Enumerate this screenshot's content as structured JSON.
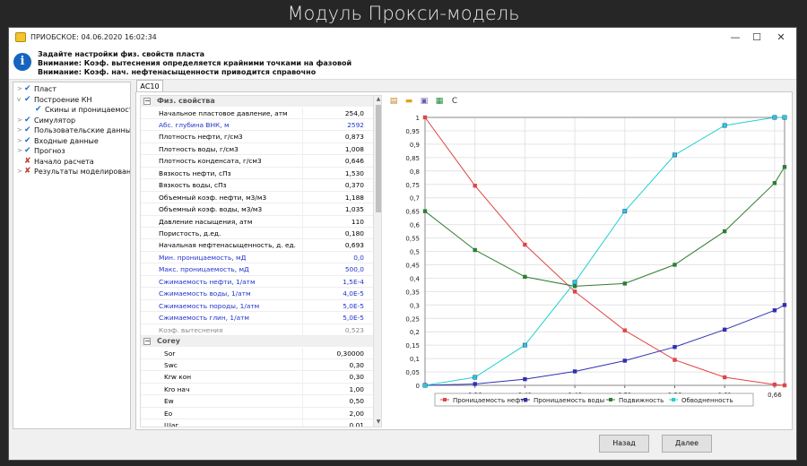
{
  "banner": "Модуль Прокси-модель",
  "window": {
    "title": "ПРИОБСКОЕ: 04.06.2020 16:02:34",
    "controls": [
      "—",
      "☐",
      "✕"
    ]
  },
  "info": {
    "lines": [
      "Задайте настройки физ. свойств пласта",
      "Внимание: Коэф. вытеснения определяется крайними точками на фазовой",
      "Внимание: Коэф. нач. нефтенасыщенности приводится справочно"
    ]
  },
  "tree": [
    {
      "label": "Пласт",
      "status": "ok",
      "level": 0,
      "expander": ">"
    },
    {
      "label": "Построение КН",
      "status": "ok",
      "level": 0,
      "expander": "v"
    },
    {
      "label": "Скины и проницаемость",
      "status": "ok",
      "level": 1,
      "expander": ""
    },
    {
      "label": "Симулятор",
      "status": "ok",
      "level": 0,
      "expander": ">"
    },
    {
      "label": "Пользовательские данные",
      "status": "ok",
      "level": 0,
      "expander": ">"
    },
    {
      "label": "Входные данные",
      "status": "ok",
      "level": 0,
      "expander": ">"
    },
    {
      "label": "Прогноз",
      "status": "ok",
      "level": 0,
      "expander": ">"
    },
    {
      "label": "Начало расчета",
      "status": "bad",
      "level": 0,
      "expander": ""
    },
    {
      "label": "Результаты моделирования",
      "status": "bad",
      "level": 0,
      "expander": ">"
    }
  ],
  "tab": "АС10",
  "properties": {
    "section1": "Физ. свойства",
    "rows1": [
      {
        "name": "Начальное пластовое давление, атм",
        "value": "254,0",
        "style": ""
      },
      {
        "name": "Абс. глубина ВНК, м",
        "value": "2592",
        "style": "blue"
      },
      {
        "name": "Плотность нефти, г/см3",
        "value": "0,873",
        "style": ""
      },
      {
        "name": "Плотность воды, г/см3",
        "value": "1,008",
        "style": ""
      },
      {
        "name": "Плотность конденсата, г/см3",
        "value": "0,646",
        "style": ""
      },
      {
        "name": "Вязкость нефти, сПз",
        "value": "1,530",
        "style": ""
      },
      {
        "name": "Вязкость воды, сПз",
        "value": "0,370",
        "style": ""
      },
      {
        "name": "Объемный коэф. нефти, м3/м3",
        "value": "1,188",
        "style": ""
      },
      {
        "name": "Объемный коэф. воды, м3/м3",
        "value": "1,035",
        "style": ""
      },
      {
        "name": "Давление насыщения, атм",
        "value": "110",
        "style": ""
      },
      {
        "name": "Пористость, д.ед.",
        "value": "0,180",
        "style": ""
      },
      {
        "name": "Начальная нефтенасыщенность, д. ед.",
        "value": "0,693",
        "style": ""
      },
      {
        "name": "Мин. проницаемость, мД",
        "value": "0,0",
        "style": "blue"
      },
      {
        "name": "Макс. проницаемость, мД",
        "value": "500,0",
        "style": "blue"
      },
      {
        "name": "Сжимаемость нефти, 1/атм",
        "value": "1,5E-4",
        "style": "blue"
      },
      {
        "name": "Сжимаемость воды, 1/атм",
        "value": "4,0E-5",
        "style": "blue"
      },
      {
        "name": "Сжимаемость породы, 1/атм",
        "value": "5,0E-5",
        "style": "blue"
      },
      {
        "name": "Сжимаемость глин, 1/атм",
        "value": "5,0E-5",
        "style": "blue"
      },
      {
        "name": "Коэф. вытеснения",
        "value": "0,523",
        "style": "gray"
      }
    ],
    "section2": "Corey",
    "rows2": [
      {
        "name": "Sor",
        "value": "0,30000",
        "style": "sub"
      },
      {
        "name": "Swc",
        "value": "0,30",
        "style": "sub"
      },
      {
        "name": "Krw кон",
        "value": "0,30",
        "style": "sub"
      },
      {
        "name": "Kro нач",
        "value": "1,00",
        "style": "sub"
      },
      {
        "name": "Ew",
        "value": "0,50",
        "style": "sub"
      },
      {
        "name": "Eo",
        "value": "2,00",
        "style": "sub"
      },
      {
        "name": "Шаг",
        "value": "0,01",
        "style": "sub"
      }
    ]
  },
  "chart_toolbar": {
    "icons": [
      "export-icon",
      "open-folder-icon",
      "save-icon",
      "excel-icon",
      "refresh-icon"
    ],
    "refresh_label": "C"
  },
  "chart_data": {
    "type": "line",
    "x": [
      0.31,
      0.36,
      0.41,
      0.46,
      0.51,
      0.56,
      0.61,
      0.66,
      0.67
    ],
    "series": [
      {
        "name": "Проницаемость нефти",
        "color": "#e04545",
        "values": [
          1.0,
          0.745,
          0.525,
          0.35,
          0.205,
          0.095,
          0.03,
          0.003,
          0.0
        ]
      },
      {
        "name": "Проницаемость воды",
        "color": "#3030b0",
        "values": [
          0.0,
          0.005,
          0.023,
          0.052,
          0.092,
          0.143,
          0.208,
          0.28,
          0.3
        ]
      },
      {
        "name": "Подвижность",
        "color": "#2e7d32",
        "values": [
          0.65,
          0.505,
          0.405,
          0.37,
          0.38,
          0.45,
          0.575,
          0.755,
          0.815
        ]
      },
      {
        "name": "Обводненность",
        "color": "#20d0d0",
        "values": [
          0.0,
          0.03,
          0.15,
          0.385,
          0.65,
          0.86,
          0.97,
          1.0,
          1.0
        ]
      }
    ],
    "xticks": [
      "0,36",
      "0,41",
      "0,46",
      "0,51",
      "0,56",
      "0,61",
      "0,66"
    ],
    "xtick_values": [
      0.36,
      0.41,
      0.46,
      0.51,
      0.56,
      0.61,
      0.66
    ],
    "yticks": [
      "0",
      "0,05",
      "0,1",
      "0,15",
      "0,2",
      "0,25",
      "0,3",
      "0,35",
      "0,4",
      "0,45",
      "0,5",
      "0,55",
      "0,6",
      "0,65",
      "0,7",
      "0,75",
      "0,8",
      "0,85",
      "0,9",
      "0,95",
      "1"
    ],
    "xlim": [
      0.31,
      0.67
    ],
    "ylim": [
      0,
      1
    ],
    "grid": true,
    "legend": "bottom"
  },
  "buttons": {
    "back": "Назад",
    "next": "Далее"
  }
}
